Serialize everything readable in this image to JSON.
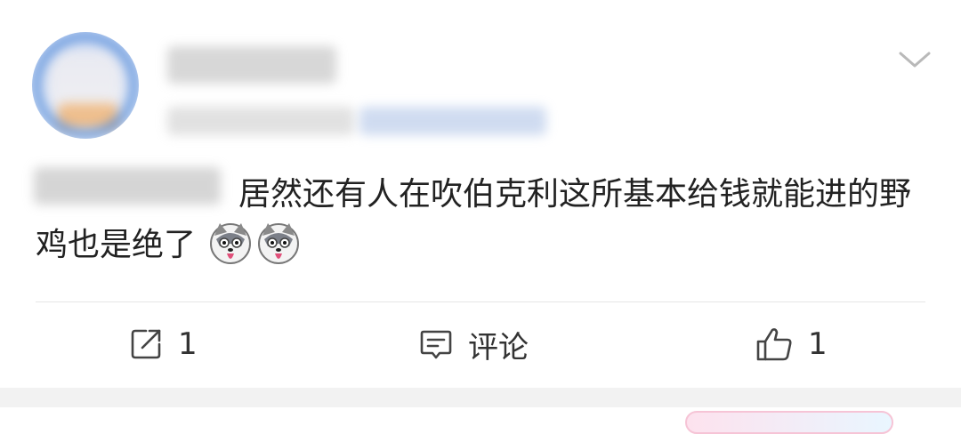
{
  "post": {
    "text": "居然还有人在吹伯克利这所基本给钱就能进的野鸡也是绝了",
    "emojis": [
      "dog-emoji",
      "dog-emoji"
    ]
  },
  "actions": {
    "repost_count": "1",
    "comment_label": "评论",
    "like_count": "1"
  },
  "colors": {
    "text": "#222222",
    "divider": "#e6e6e6",
    "section_gap": "#f2f2f2",
    "avatar_ring": "#3f7fd6"
  }
}
